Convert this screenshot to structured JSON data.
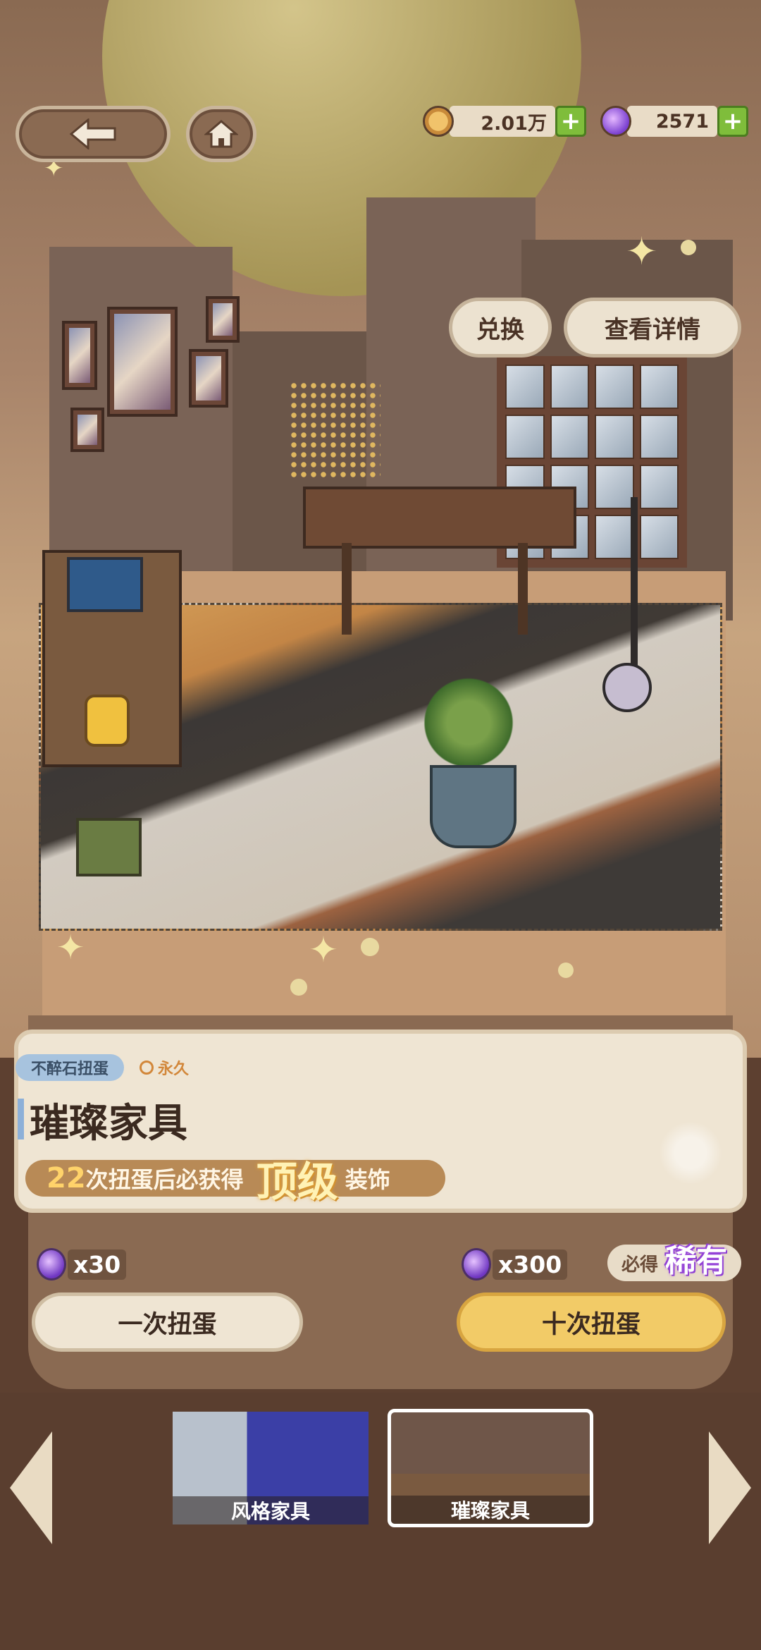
{
  "top_bar": {
    "back_icon": "arrow-left-icon",
    "home_icon": "home-icon",
    "coins": {
      "icon": "coin-icon",
      "value": "2.01万"
    },
    "gems": {
      "icon": "gem-icon",
      "value": "2571"
    },
    "plus": "+"
  },
  "scene_buttons": {
    "exchange": "兑换",
    "details": "查看详情"
  },
  "pool": {
    "tag": "不醉石扭蛋",
    "duration": "永久",
    "title": "璀璨家具",
    "guarantee_count": "22",
    "guarantee_text_a": "次扭蛋后必获得",
    "guarantee_top": "顶级",
    "guarantee_text_b": "装饰"
  },
  "gacha": {
    "single_cost": "x30",
    "single_label": "一次扭蛋",
    "ten_cost": "x300",
    "ten_label": "十次扭蛋",
    "badge_must": "必得",
    "badge_rare": "稀有"
  },
  "tabs": [
    {
      "label": "风格家具",
      "selected": false
    },
    {
      "label": "璀璨家具",
      "selected": true
    }
  ],
  "colors": {
    "accent_yellow": "#f2cb67",
    "plus_green": "#7fbd3b",
    "tag_blue": "#a7c3de",
    "panel_brown": "#8a6a52"
  }
}
